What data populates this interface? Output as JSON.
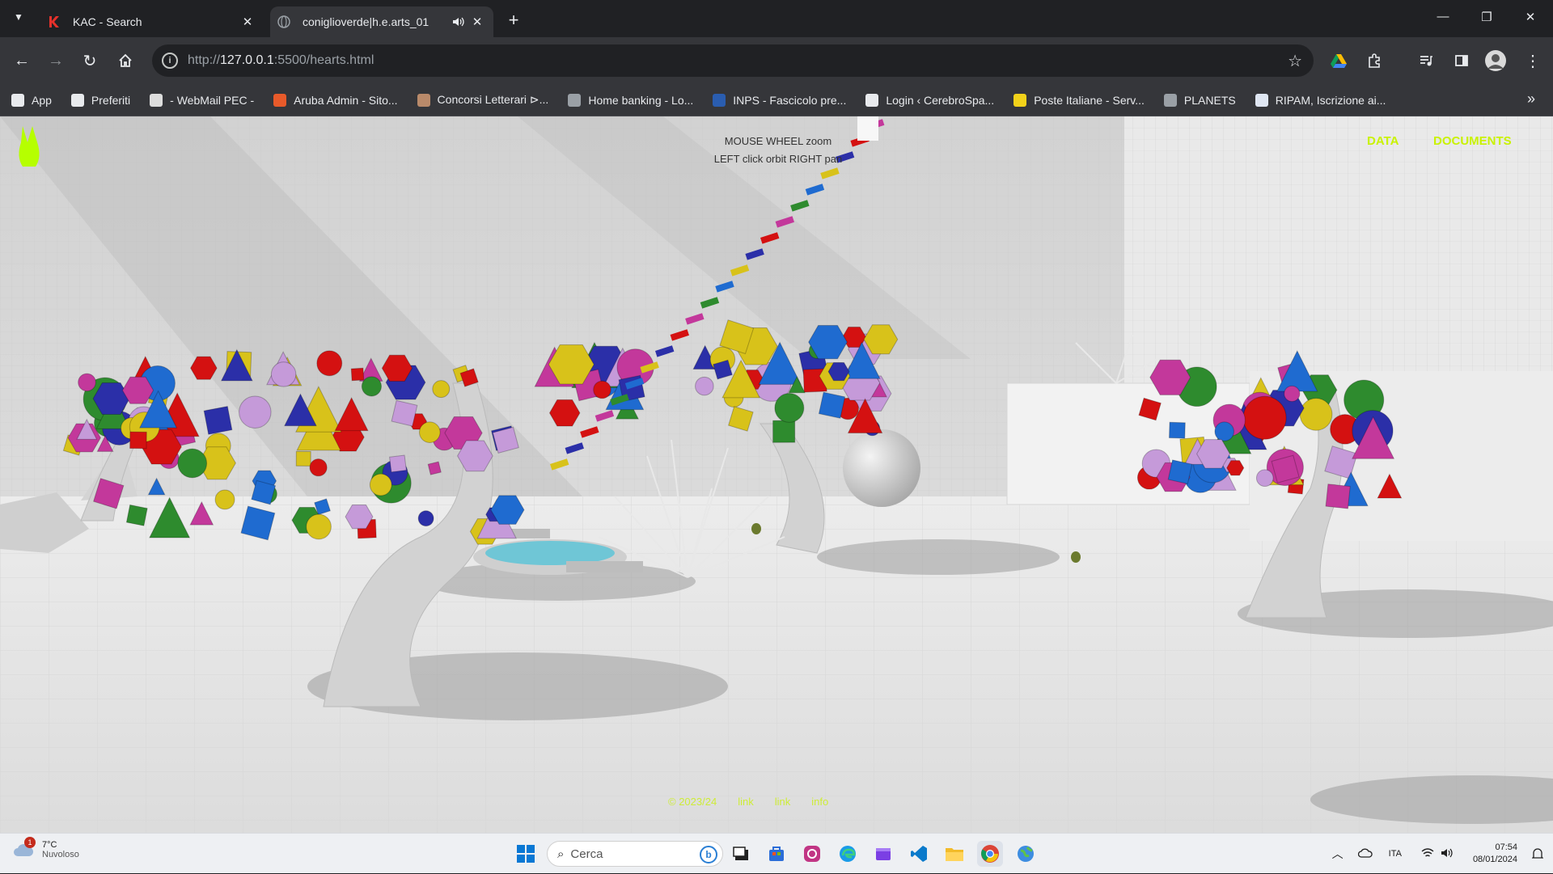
{
  "browser": {
    "tabs": [
      {
        "title": "KAC - Search",
        "icon": "k-logo-icon",
        "active": false
      },
      {
        "title": "coniglioverde|h.e.arts_01",
        "icon": "globe-icon",
        "active": true,
        "audio": "speaker-icon"
      }
    ],
    "address": {
      "scheme": "http://",
      "host": "127.0.0.1",
      "path": ":5500/hearts.html"
    },
    "bookmarks": [
      {
        "label": "App",
        "icon": "apps-grid-icon",
        "color": "#e8eaed"
      },
      {
        "label": "Preferiti",
        "icon": "folder-icon",
        "color": "#e8eaed"
      },
      {
        "label": "- WebMail PEC -",
        "icon": "mail-icon",
        "color": "#dddddd"
      },
      {
        "label": "Aruba Admin - Sito...",
        "icon": "aruba-icon",
        "color": "#e85a2a"
      },
      {
        "label": "Concorsi Letterari ⊳...",
        "icon": "book-icon",
        "color": "#b98a6a"
      },
      {
        "label": "Home banking - Lo...",
        "icon": "globe-icon",
        "color": "#9aa0a6"
      },
      {
        "label": "INPS - Fascicolo pre...",
        "icon": "inps-icon",
        "color": "#2a5db0"
      },
      {
        "label": "Login ‹ CerebroSpa...",
        "icon": "wordpress-icon",
        "color": "#e8eaed"
      },
      {
        "label": "Poste Italiane - Serv...",
        "icon": "poste-icon",
        "color": "#f2d21a"
      },
      {
        "label": "PLANETS",
        "icon": "globe-icon",
        "color": "#9aa0a6"
      },
      {
        "label": "RIPAM, Iscrizione ai...",
        "icon": "doc-icon",
        "color": "#dfe6f2"
      }
    ]
  },
  "page": {
    "help_line1": "MOUSE WHEEL zoom",
    "help_line2": "LEFT click orbit RIGHT pan",
    "nav_data": "DATA",
    "nav_documents": "DOCUMENTS",
    "footer_links": [
      "© 2023/24",
      "link",
      "link",
      "info"
    ],
    "accent": "#c9f200"
  },
  "taskbar": {
    "weather_temp": "7°C",
    "weather_desc": "Nuvoloso",
    "weather_badge": "1",
    "search_placeholder": "Cerca",
    "apps": [
      "start-icon",
      "task-view-icon",
      "store-icon",
      "instagram-icon",
      "edge-icon",
      "clipchamp-icon",
      "vscode-icon",
      "file-explorer-icon",
      "chrome-icon",
      "earth-icon"
    ],
    "language": "ITA",
    "time": "07:54",
    "date": "08/01/2024"
  }
}
